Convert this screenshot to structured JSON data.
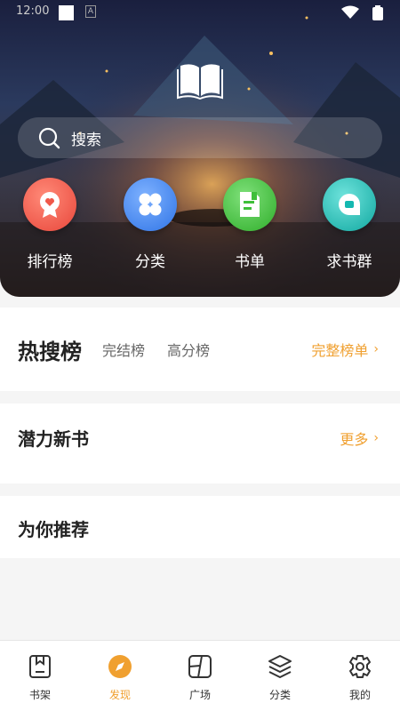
{
  "status_bar": {
    "time": "12:00"
  },
  "header": {
    "logo": "open-book-icon",
    "search": {
      "placeholder": "搜索"
    },
    "shortcuts": [
      {
        "label": "排行榜",
        "icon": "ranking-badge-icon",
        "color": "#f0584a"
      },
      {
        "label": "分类",
        "icon": "category-grid-icon",
        "color": "#3a86f0"
      },
      {
        "label": "书单",
        "icon": "booklist-icon",
        "color": "#3fbf3a"
      },
      {
        "label": "求书群",
        "icon": "chat-bubble-icon",
        "color": "#15b8b0"
      }
    ]
  },
  "hot_search": {
    "title": "热搜榜",
    "tabs": [
      "完结榜",
      "高分榜"
    ],
    "more_label": "完整榜单"
  },
  "potential_new": {
    "title": "潜力新书",
    "more_label": "更多"
  },
  "recommend": {
    "title": "为你推荐"
  },
  "bottom_nav": {
    "items": [
      {
        "label": "书架",
        "icon": "bookshelf-icon"
      },
      {
        "label": "发现",
        "icon": "compass-icon",
        "active": true
      },
      {
        "label": "广场",
        "icon": "square-icon"
      },
      {
        "label": "分类",
        "icon": "layers-icon"
      },
      {
        "label": "我的",
        "icon": "gear-icon"
      }
    ]
  },
  "colors": {
    "accent": "#f0a030"
  }
}
